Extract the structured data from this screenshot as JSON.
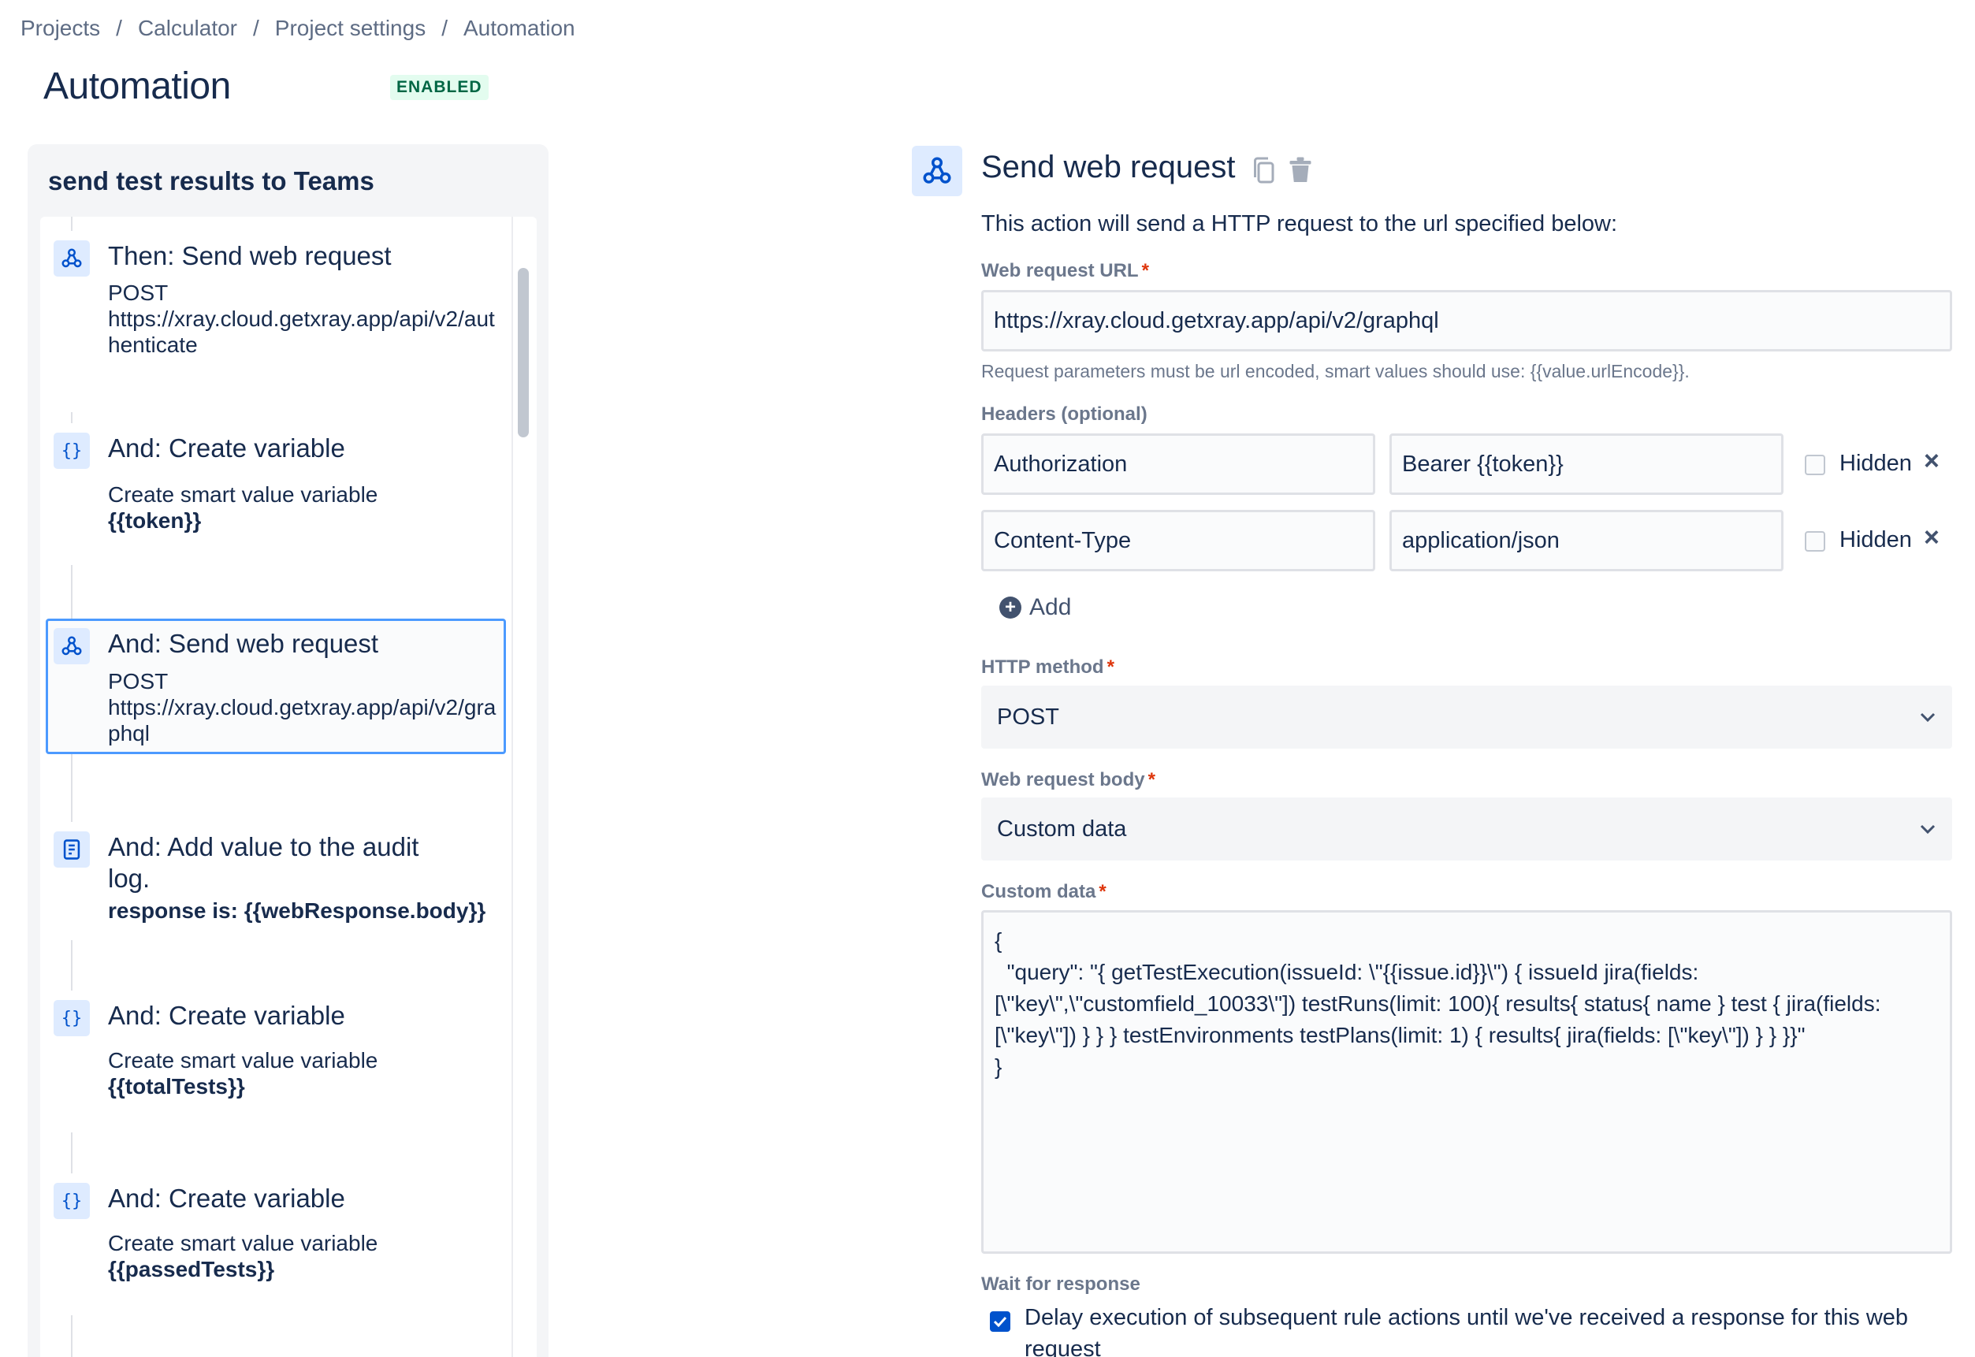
{
  "breadcrumb": {
    "items": [
      "Projects",
      "Calculator",
      "Project settings",
      "Automation"
    ],
    "separator": "/"
  },
  "page": {
    "title": "Automation",
    "status": "ENABLED"
  },
  "rule": {
    "name": "send test results to Teams",
    "components": [
      {
        "icon": "webhook-icon",
        "title": "Then: Send web request",
        "line1": "POST",
        "line2": "https://xray.cloud.getxray.app/api/v2/authenticate"
      },
      {
        "icon": "braces-icon",
        "title": "And: Create variable",
        "line1": "Create smart value variable",
        "line2": "{{token}}"
      },
      {
        "icon": "webhook-icon",
        "title": "And: Send web request",
        "line1": "POST",
        "line2": "https://xray.cloud.getxray.app/api/v2/graphql"
      },
      {
        "icon": "audit-log-icon",
        "title": "And: Add value to the audit log.",
        "line1": "",
        "line2": "response is: {{webResponse.body}}"
      },
      {
        "icon": "braces-icon",
        "title": "And: Create variable",
        "line1": "Create smart value variable",
        "line2": "{{totalTests}}"
      },
      {
        "icon": "braces-icon",
        "title": "And: Create variable",
        "line1": "Create smart value variable",
        "line2": "{{passedTests}}"
      }
    ]
  },
  "action": {
    "title": "Send web request",
    "description": "This action will send a HTTP request to the url specified below:",
    "url_label": "Web request URL",
    "url_value": "https://xray.cloud.getxray.app/api/v2/graphql",
    "url_helper": "Request parameters must be url encoded, smart values should use: {{value.urlEncode}}.",
    "headers_label": "Headers (optional)",
    "headers": [
      {
        "name": "Authorization",
        "value": "Bearer {{token}}",
        "hidden_label": "Hidden"
      },
      {
        "name": "Content-Type",
        "value": "application/json",
        "hidden_label": "Hidden"
      }
    ],
    "add_label": "Add",
    "method_label": "HTTP method",
    "method_value": "POST",
    "body_label": "Web request body",
    "body_value": "Custom data",
    "custom_label": "Custom data",
    "custom_value": "{\n  \"query\": \"{ getTestExecution(issueId: \\\"{{issue.id}}\\\") { issueId jira(fields: [\\\"key\\\",\\\"customfield_10033\\\"]) testRuns(limit: 100){ results{ status{ name } test { jira(fields: [\\\"key\\\"]) } } } testEnvironments testPlans(limit: 1) { results{ jira(fields: [\\\"key\\\"]) } } }}\"\n}",
    "wait_label": "Wait for response",
    "wait_text": "Delay execution of subsequent rule actions until we've received a response for this web request",
    "wait_checked": true,
    "required_mark": "*"
  },
  "colors": {
    "accent": "#0052cc",
    "focus": "#4c9aff",
    "enabled_bg": "#e3fcef",
    "enabled_text": "#006644",
    "required": "#de350b"
  }
}
